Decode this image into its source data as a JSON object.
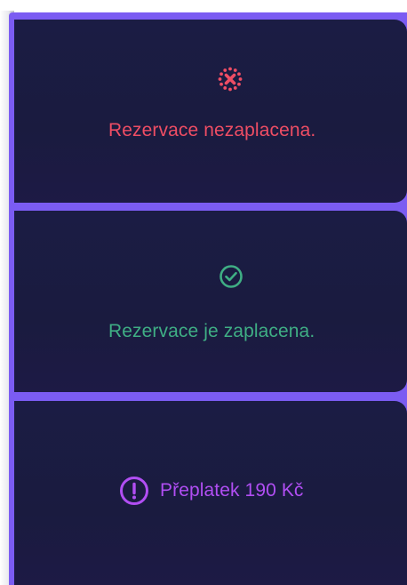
{
  "colors": {
    "accent_purple": "#7b5cf2",
    "card_bg": "#1b1c44",
    "unpaid": "#ee4d64",
    "paid": "#3fae84",
    "overpaid": "#b14ef3"
  },
  "cards": [
    {
      "status": "unpaid",
      "icon": "dotted-circle-x-icon",
      "text": "Rezervace nezaplacena."
    },
    {
      "status": "paid",
      "icon": "circle-check-icon",
      "text": "Rezervace je zaplacena."
    },
    {
      "status": "overpaid",
      "icon": "circle-exclamation-icon",
      "text": "Přeplatek 190 Kč"
    }
  ]
}
